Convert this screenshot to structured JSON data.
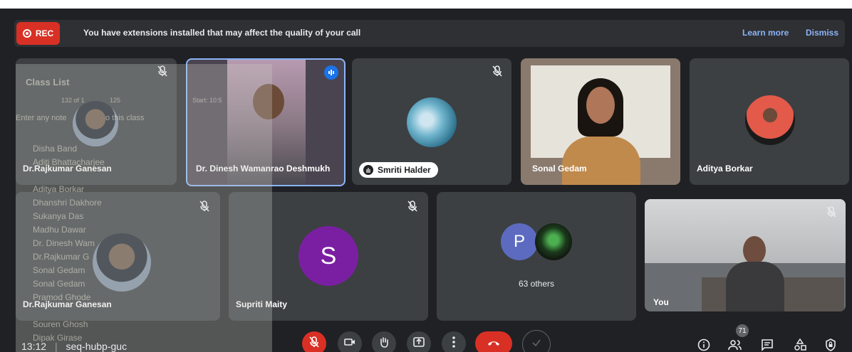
{
  "banner": {
    "rec_label": "REC",
    "message": "You have extensions installed that may affect the quality of your call",
    "learn_more": "Learn more",
    "dismiss": "Dismiss"
  },
  "tiles": {
    "rajkumar_top": "Dr.Rajkumar Ganesan",
    "dinesh": "Dr. Dinesh Wamanrao Deshmukh",
    "smriti": "Smriti Halder",
    "sonal": "Sonal Gedam",
    "aditya": "Aditya Borkar",
    "rajkumar_bottom": "Dr.Rajkumar Ganesan",
    "supriti": "Supriti Maity",
    "s_letter": "S",
    "p_letter": "P",
    "others": "63 others",
    "you": "You"
  },
  "class_list": {
    "title": "Class List",
    "stats": "132 of 1",
    "stats2": "125",
    "start": "Start: 10:5",
    "hint": "Enter any note",
    "hint2": "o this class",
    "names": [
      "Disha Band",
      "Aditi Bhattacharjee",
      "Aditya Borkar",
      "Dhanshri Dakhore",
      "Sukanya Das",
      "Madhu Dawar",
      "Dr. Dinesh Wam",
      "Dr.Rajkumar G",
      "Sonal Gedam",
      "Sonal Gedam",
      "Pramod Ghode",
      "Souren Ghosh",
      "Dipak Girase"
    ]
  },
  "bottom": {
    "time": "13:12",
    "separator": "|",
    "meeting_code": "seq-hubp-guc",
    "participant_count": "71"
  },
  "colors": {
    "background": "#202124",
    "tile": "#3c4043",
    "red": "#d93025",
    "blue": "#1a73e8",
    "link": "#8ab4f8",
    "s_avatar": "#7b1fa2",
    "p_avatar": "#5c6bc0"
  }
}
